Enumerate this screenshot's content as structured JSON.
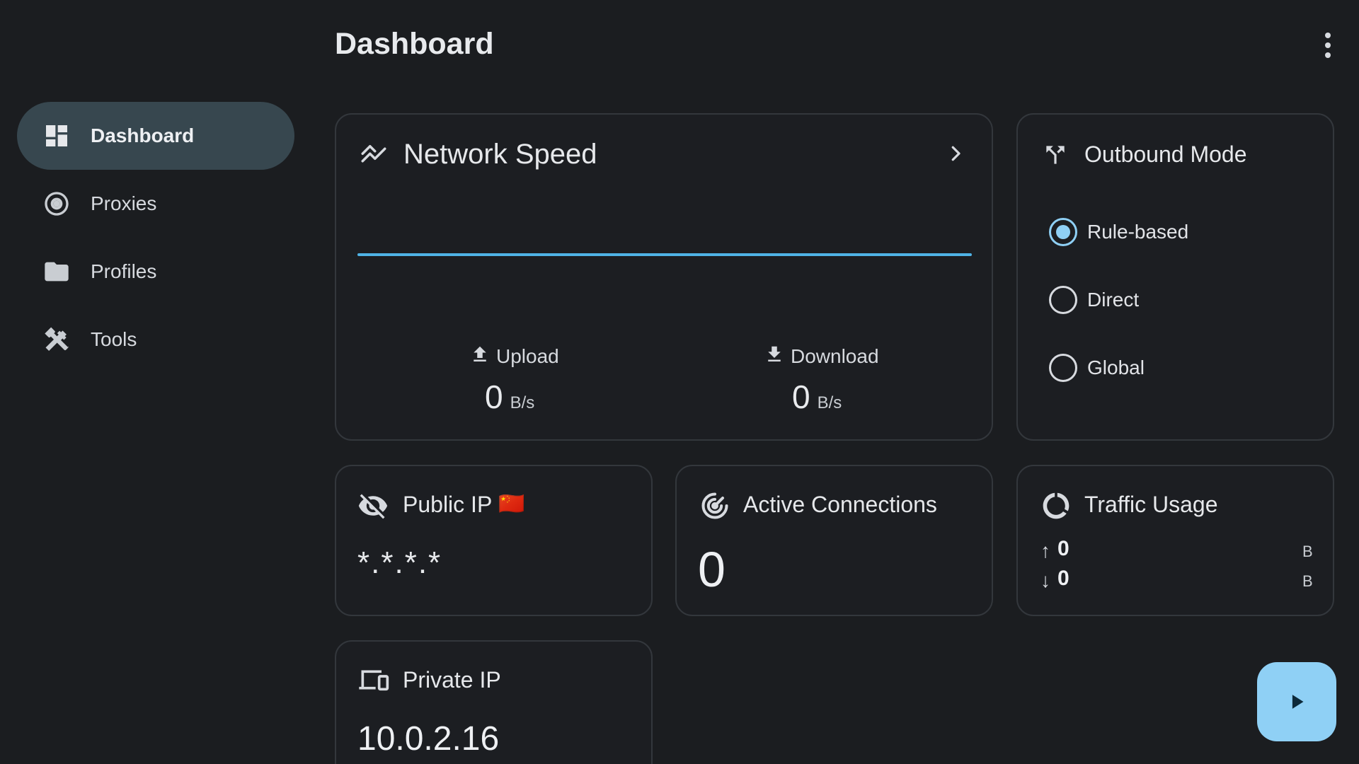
{
  "header": {
    "title": "Dashboard",
    "more_icon": "more-vert-icon"
  },
  "sidebar": {
    "items": [
      {
        "label": "Dashboard",
        "icon": "dashboard-icon",
        "active": true
      },
      {
        "label": "Proxies",
        "icon": "radio-target-icon",
        "active": false
      },
      {
        "label": "Profiles",
        "icon": "folder-icon",
        "active": false
      },
      {
        "label": "Tools",
        "icon": "tools-icon",
        "active": false
      }
    ]
  },
  "network_speed": {
    "title": "Network Speed",
    "upload_label": "Upload",
    "upload_value": "0",
    "upload_unit": "B/s",
    "download_label": "Download",
    "download_value": "0",
    "download_unit": "B/s",
    "line_color": "#4fb3e6"
  },
  "outbound_mode": {
    "title": "Outbound Mode",
    "options": [
      {
        "label": "Rule-based",
        "selected": true
      },
      {
        "label": "Direct",
        "selected": false
      },
      {
        "label": "Global",
        "selected": false
      }
    ]
  },
  "public_ip": {
    "title": "Public IP",
    "flag": "🇨🇳",
    "value": "*.*.*.*"
  },
  "active_connections": {
    "title": "Active Connections",
    "value": "0"
  },
  "traffic_usage": {
    "title": "Traffic Usage",
    "up_arrow": "↑",
    "up_value": "0",
    "up_unit": "B",
    "down_arrow": "↓",
    "down_value": "0",
    "down_unit": "B"
  },
  "private_ip": {
    "title": "Private IP",
    "value": "10.0.2.16"
  },
  "colors": {
    "accent": "#8fd0f5",
    "active_nav": "#37474f",
    "background": "#1b1d20"
  }
}
